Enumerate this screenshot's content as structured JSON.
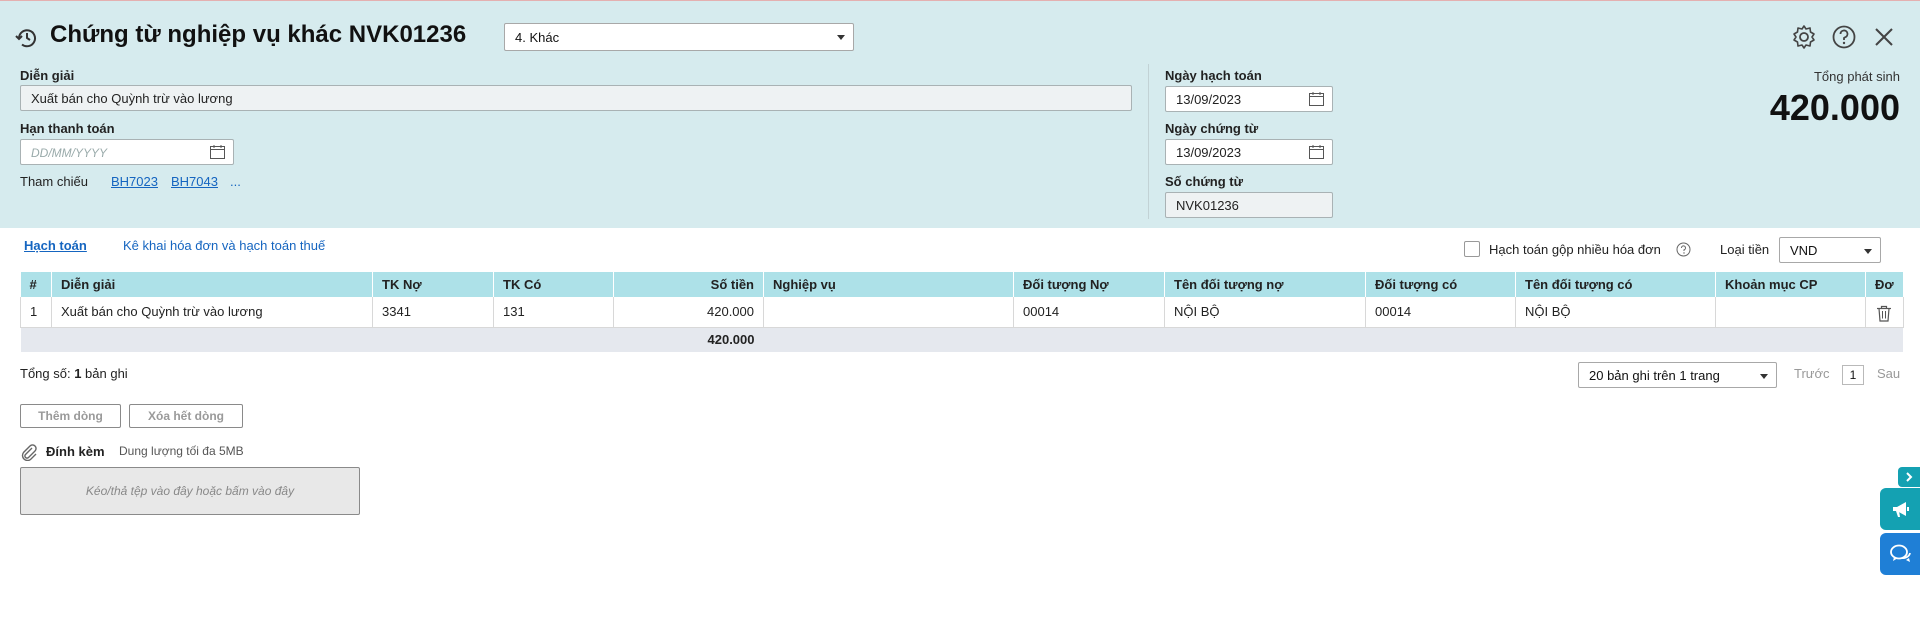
{
  "header": {
    "title": "Chứng từ nghiệp vụ khác NVK01236",
    "type_select": "4. Khác",
    "description_label": "Diễn giải",
    "description_value": "Xuất bán cho Quỳnh trừ vào lương",
    "due_date_label": "Hạn thanh toán",
    "due_date_placeholder": "DD/MM/YYYY",
    "reference_label": "Tham chiếu",
    "references": [
      "BH7023",
      "BH7043",
      "..."
    ],
    "posting_date_label": "Ngày hạch toán",
    "posting_date_value": "13/09/2023",
    "voucher_date_label": "Ngày chứng từ",
    "voucher_date_value": "13/09/2023",
    "voucher_no_label": "Số chứng từ",
    "voucher_no_value": "NVK01236",
    "total_label": "Tổng phát sinh",
    "total_value": "420.000"
  },
  "icons": {
    "history": "history-icon",
    "settings": "gear-icon",
    "help": "help-icon",
    "close": "close-icon"
  },
  "tabs": {
    "accounting": "Hạch toán",
    "invoice_tax": "Kê khai hóa đơn và hạch toán thuế"
  },
  "options": {
    "merge_invoices_label": "Hạch toán gộp nhiều hóa đơn",
    "currency_label": "Loại tiền",
    "currency_value": "VND"
  },
  "grid": {
    "columns": [
      "#",
      "Diễn giải",
      "TK Nợ",
      "TK Có",
      "Số tiền",
      "Nghiệp vụ",
      "Đối tượng Nợ",
      "Tên đối tượng nợ",
      "Đối tượng có",
      "Tên đối tượng có",
      "Khoản mục CP",
      "Đơ"
    ],
    "rows": [
      [
        "1",
        "Xuất bán cho Quỳnh trừ vào lương",
        "3341",
        "131",
        "420.000",
        "",
        "00014",
        "NỘI BỘ",
        "00014",
        "NỘI BỘ",
        "",
        ""
      ]
    ],
    "sum_amount": "420.000"
  },
  "footer": {
    "total_records_prefix": "Tổng số: ",
    "total_records_count": "1",
    "total_records_suffix": " bản ghi",
    "page_size": "20 bản ghi trên 1 trang",
    "prev": "Trước",
    "page": "1",
    "next": "Sau",
    "add_row": "Thêm dòng",
    "delete_all_rows": "Xóa hết dòng",
    "attach_label": "Đính kèm",
    "attach_limit": "Dung lượng tối đa 5MB",
    "dropzone_text": "Kéo/thả tệp vào đây hoặc bấm vào đây"
  },
  "colors": {
    "header_bg": "#d6ebee",
    "grid_header_bg": "#ade1e8",
    "link": "#1565c0",
    "teal_button": "#14a1b2",
    "blue_button": "#1f7fd6"
  }
}
